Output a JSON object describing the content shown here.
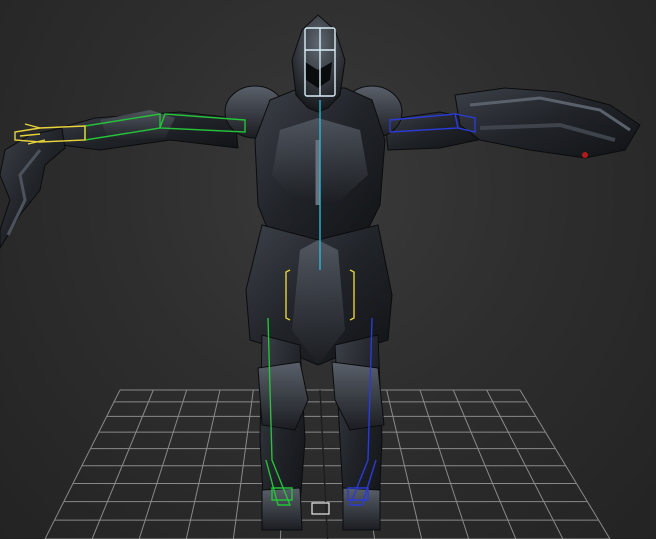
{
  "viewport": {
    "background_color": "#2e2e2e",
    "grid_color": "#9a9a9a",
    "bone_colors": {
      "spine": "#2fb5d6",
      "head": "#d9eef8",
      "right_side": "#25c23a",
      "left_side": "#2a3bd8",
      "hands_pelvis": "#e6d23a"
    },
    "icons": [
      "ground-grid",
      "character-model",
      "biped-skeleton",
      "pivot-marker"
    ]
  }
}
